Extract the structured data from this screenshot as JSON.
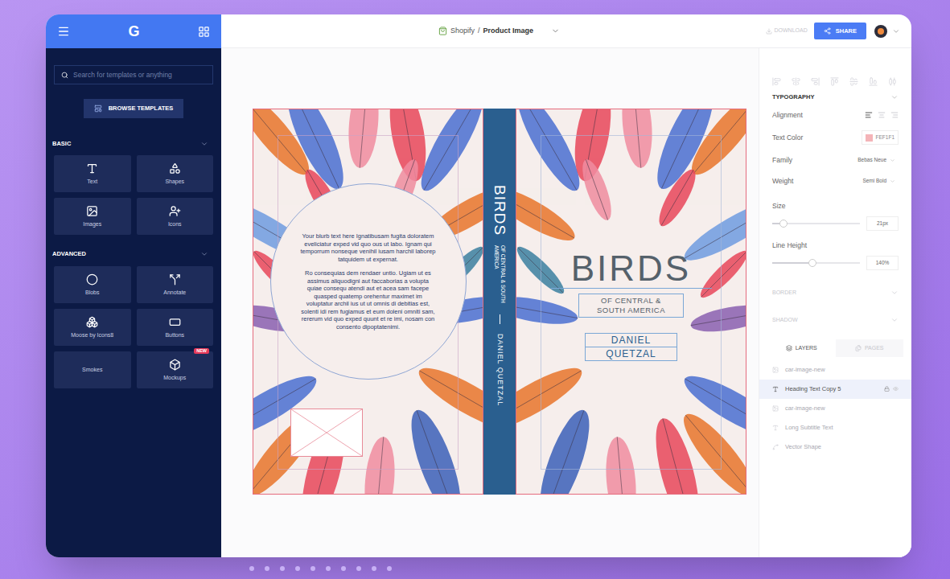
{
  "topbar": {
    "logo": "G",
    "breadcrumb": {
      "app": "Shopify",
      "separator": "/",
      "page": "Product Image"
    },
    "download": "DOWNLOAD",
    "share": "SHARE"
  },
  "sidebar": {
    "search": {
      "placeholder": "Search for templates or anything"
    },
    "browse_button": "BROWSE TEMPLATES",
    "sections": [
      {
        "title": "BASIC",
        "expanded": true,
        "tiles": [
          {
            "label": "Text",
            "badge": ""
          },
          {
            "label": "Shapes",
            "badge": ""
          },
          {
            "label": "Images",
            "badge": ""
          },
          {
            "label": "Icons",
            "badge": ""
          }
        ]
      },
      {
        "title": "ADVANCED",
        "expanded": true,
        "tiles": [
          {
            "label": "Blobs",
            "badge": ""
          },
          {
            "label": "Annotate",
            "badge": ""
          },
          {
            "label": "Moose by Icons8",
            "badge": ""
          },
          {
            "label": "Buttons",
            "badge": ""
          },
          {
            "label": "Smokes",
            "badge": ""
          },
          {
            "label": "Mockups",
            "badge": "NEW"
          }
        ]
      }
    ]
  },
  "canvas": {
    "back_cover": {
      "blurb": [
        "Your blurb text here Ignatibusam fugita doloratem eveliciatur exped vid quo ous ut labo. Ignam qui temporrum nonseque venihil iusam harchil laborep tatquidem ut expernat.",
        "Ro consequias dem rendaer untio. Ugiam ut es assimus aliquodigni aut faccaborias a volupta quiae consequ atendi aut et acea sam facepe quasped quatemp orehentur maximet im voluptatur archil ius ut ut omnis di debitias est, solenti idi rem fugiamus et eum doleni omniti sam, rererum vid quo exped quunt et re imi, nosam con consento dipoptatenimi."
      ]
    },
    "spine": {
      "title": "BIRDS",
      "subtitle": "OF CENTRAL & SOUTH AMERICA",
      "author": "DANIEL QUETZAL"
    },
    "front_cover": {
      "title": "BIRDS",
      "subtitle_lines": [
        "OF CENTRAL &",
        "SOUTH AMERICA"
      ],
      "author_lines": [
        "DANIEL",
        "QUETZAL"
      ]
    }
  },
  "properties": {
    "section": {
      "title": "TYPOGRAPHY",
      "expanded": true
    },
    "fields": [
      {
        "label": "Alignment",
        "kind": "alignment",
        "options": [
          {
            "selected": true
          },
          {
            "selected": false
          },
          {
            "selected": false
          }
        ]
      },
      {
        "label": "Text Color",
        "kind": "color",
        "value": "FEF1F1",
        "color": "#f4b4b8"
      },
      {
        "label": "Family",
        "kind": "select",
        "value": "Bebas Neue"
      },
      {
        "label": "Weight",
        "kind": "select",
        "value": "Semi Bold"
      },
      {
        "label": "Size",
        "kind": "slider",
        "level": 0.13,
        "value": "21px"
      },
      {
        "label": "Line Height",
        "kind": "slider",
        "level": 0.46,
        "value": "140%"
      }
    ],
    "collapsed_sections": [
      {
        "title": "BORDER",
        "expanded": false
      },
      {
        "title": "SHADOW",
        "expanded": false
      }
    ],
    "tabs": [
      {
        "label": "LAYERS",
        "selected": true
      },
      {
        "label": "PAGES",
        "selected": false
      }
    ],
    "layers": [
      {
        "name": "car-image-new",
        "kind": "image",
        "selected": false
      },
      {
        "name": "Heading Text Copy 5",
        "kind": "text",
        "selected": true
      },
      {
        "name": "car-image-new",
        "kind": "image",
        "selected": false
      },
      {
        "name": "Long Subtitle Text",
        "kind": "text",
        "selected": false
      },
      {
        "name": "Vector Shape",
        "kind": "vector",
        "selected": false
      }
    ]
  },
  "pager": {
    "dots": [
      {
        "selected": false
      },
      {
        "selected": false
      },
      {
        "selected": false
      },
      {
        "selected": false
      },
      {
        "selected": false
      },
      {
        "selected": false
      },
      {
        "selected": false
      },
      {
        "selected": false
      },
      {
        "selected": false
      },
      {
        "selected": false
      }
    ]
  }
}
